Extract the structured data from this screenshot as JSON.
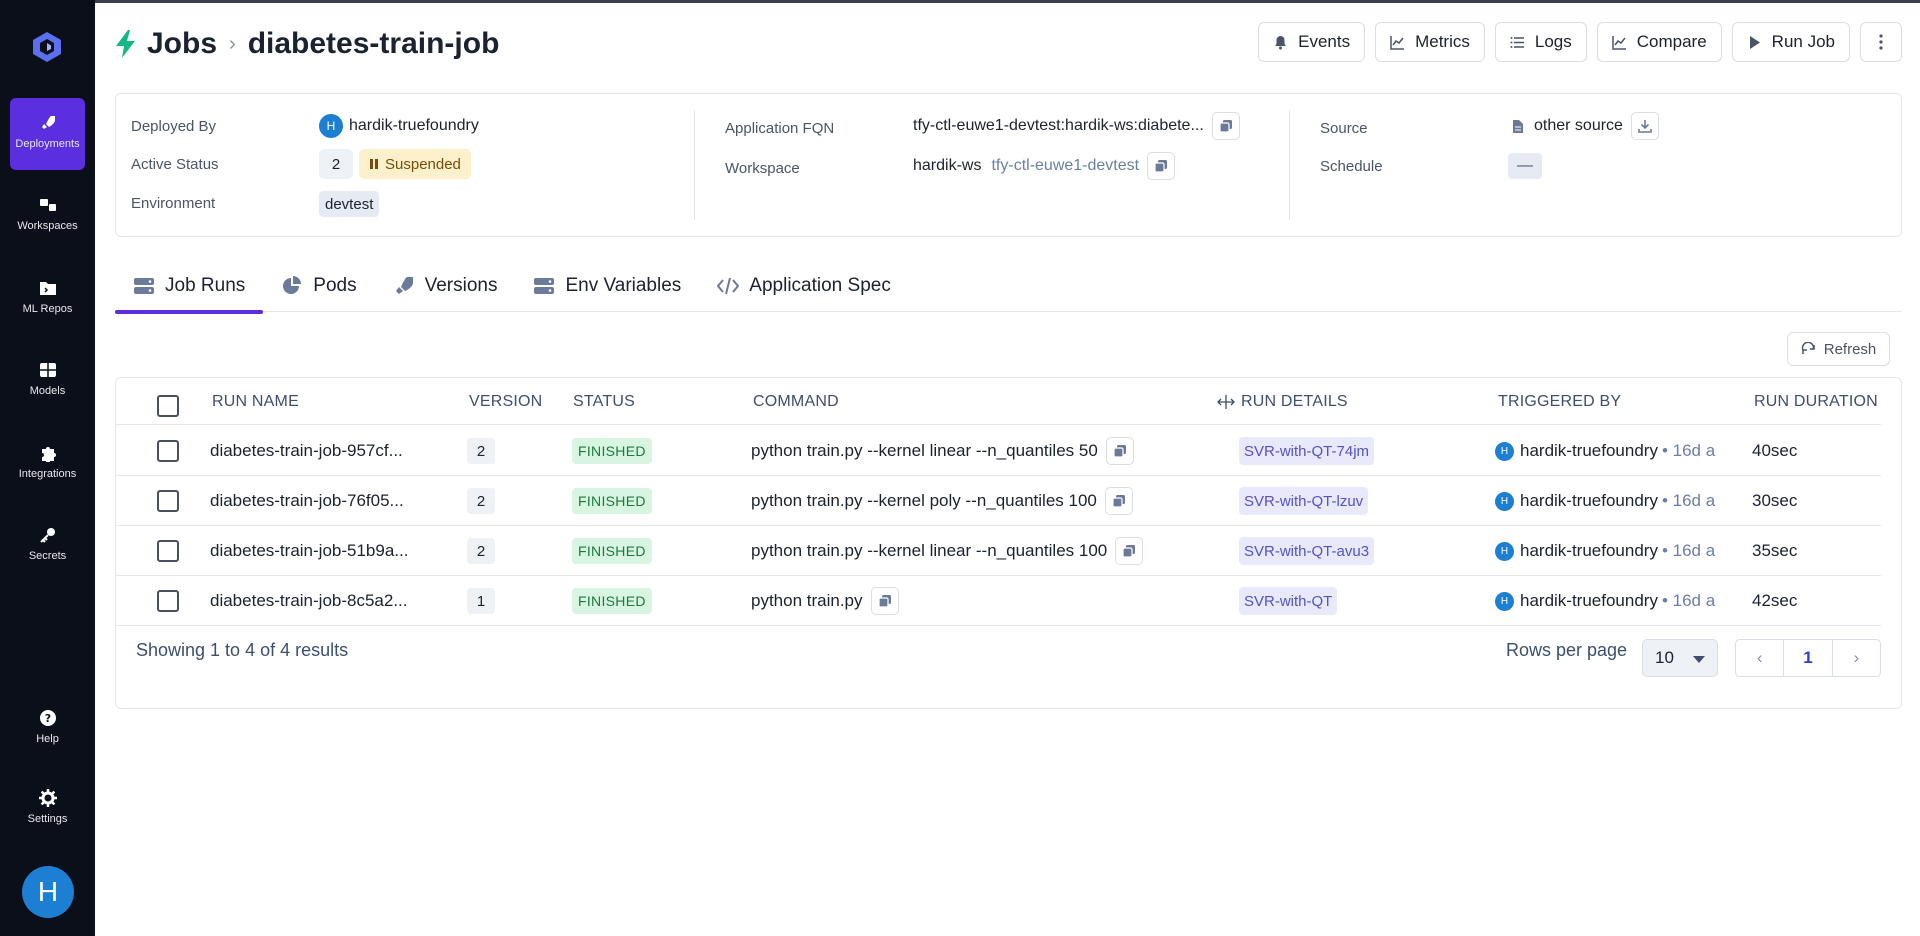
{
  "sidebar": {
    "items": [
      {
        "label": "Deployments",
        "icon": "rocket-icon"
      },
      {
        "label": "Workspaces",
        "icon": "workspace-icon"
      },
      {
        "label": "ML Repos",
        "icon": "folder-icon"
      },
      {
        "label": "Models",
        "icon": "grid-icon"
      },
      {
        "label": "Integrations",
        "icon": "puzzle-icon"
      },
      {
        "label": "Secrets",
        "icon": "key-icon"
      },
      {
        "label": "Help",
        "icon": "help-icon"
      },
      {
        "label": "Settings",
        "icon": "gear-icon"
      }
    ],
    "avatar_letter": "H",
    "active_color": "#5b2ee0"
  },
  "header": {
    "breadcrumb_root": "Jobs",
    "page_title": "diabetes-train-job",
    "buttons": {
      "events": "Events",
      "metrics": "Metrics",
      "logs": "Logs",
      "compare": "Compare",
      "run_job": "Run Job"
    }
  },
  "info": {
    "deployed_by_label": "Deployed By",
    "deployed_by_value": "hardik-truefoundry",
    "deployed_by_avatar": "H",
    "active_status_label": "Active Status",
    "active_status_count": "2",
    "active_status_state": "Suspended",
    "environment_label": "Environment",
    "environment_value": "devtest",
    "app_fqn_label": "Application FQN",
    "app_fqn_value": "tfy-ctl-euwe1-devtest:hardik-ws:diabete...",
    "workspace_label": "Workspace",
    "workspace_name": "hardik-ws",
    "workspace_cluster": "tfy-ctl-euwe1-devtest",
    "source_label": "Source",
    "source_value": "other source",
    "schedule_label": "Schedule",
    "schedule_value": "—"
  },
  "tabs": [
    {
      "label": "Job Runs",
      "icon": "server-icon",
      "active": true
    },
    {
      "label": "Pods",
      "icon": "pie-icon",
      "active": false
    },
    {
      "label": "Versions",
      "icon": "rocket-icon",
      "active": false
    },
    {
      "label": "Env Variables",
      "icon": "server-icon",
      "active": false
    },
    {
      "label": "Application Spec",
      "icon": "code-icon",
      "active": false
    }
  ],
  "refresh_label": "Refresh",
  "table": {
    "columns": [
      "RUN NAME",
      "VERSION",
      "STATUS",
      "COMMAND",
      "RUN DETAILS",
      "TRIGGERED BY",
      "RUN DURATION"
    ],
    "rows": [
      {
        "run_name": "diabetes-train-job-957cf...",
        "version": "2",
        "status": "FINISHED",
        "command": "python train.py --kernel linear --n_quantiles 50",
        "run_details": "SVR-with-QT-74jm",
        "triggered_by": "hardik-truefoundry",
        "avatar": "H",
        "ago": "• 16d a",
        "duration": "40sec"
      },
      {
        "run_name": "diabetes-train-job-76f05...",
        "version": "2",
        "status": "FINISHED",
        "command": "python train.py --kernel poly --n_quantiles 100",
        "run_details": "SVR-with-QT-lzuv",
        "triggered_by": "hardik-truefoundry",
        "avatar": "H",
        "ago": "• 16d a",
        "duration": "30sec"
      },
      {
        "run_name": "diabetes-train-job-51b9a...",
        "version": "2",
        "status": "FINISHED",
        "command": "python train.py --kernel linear --n_quantiles 100",
        "run_details": "SVR-with-QT-avu3",
        "triggered_by": "hardik-truefoundry",
        "avatar": "H",
        "ago": "• 16d a",
        "duration": "35sec"
      },
      {
        "run_name": "diabetes-train-job-8c5a2...",
        "version": "1",
        "status": "FINISHED",
        "command": "python train.py",
        "run_details": "SVR-with-QT",
        "triggered_by": "hardik-truefoundry",
        "avatar": "H",
        "ago": "• 16d a",
        "duration": "42sec"
      }
    ],
    "footer_text": "Showing 1 to 4 of 4 results",
    "rows_per_page_label": "Rows per page",
    "rows_per_page_value": "10",
    "current_page": "1"
  }
}
